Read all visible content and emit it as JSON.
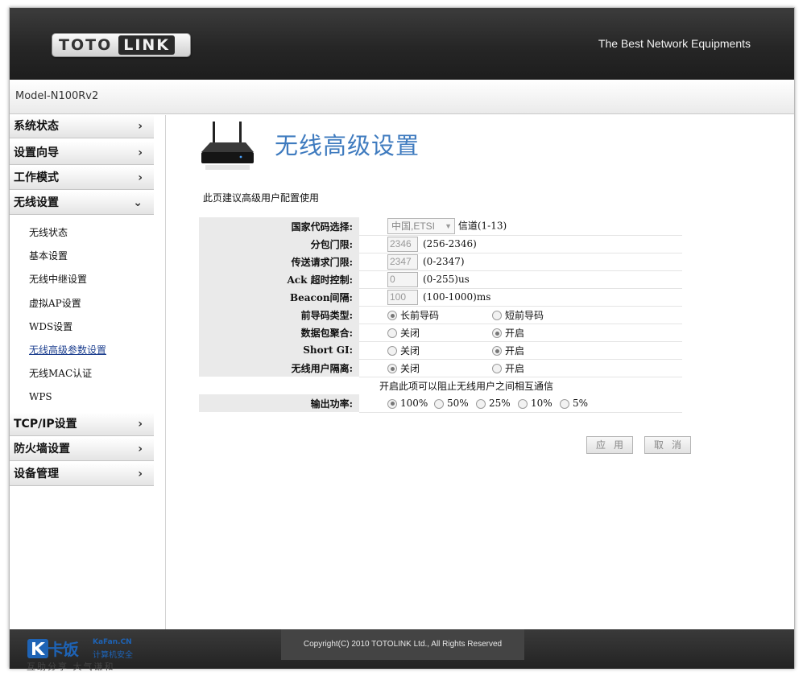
{
  "header": {
    "logo_left": "TOTO",
    "logo_right": "LINK",
    "slogan": "The Best Network Equipments"
  },
  "model": "Model-N100Rv2",
  "sidebar": {
    "groups": [
      {
        "label": "系统状态",
        "chevron": "›"
      },
      {
        "label": "设置向导",
        "chevron": "›"
      },
      {
        "label": "工作模式",
        "chevron": "›"
      },
      {
        "label": "无线设置",
        "chevron": "⌄"
      }
    ],
    "wireless_items": [
      "无线状态",
      "基本设置",
      "无线中继设置",
      "虚拟AP设置",
      "WDS设置",
      "无线高级参数设置",
      "无线MAC认证",
      "WPS"
    ],
    "groups_after": [
      {
        "label": "TCP/IP设置",
        "chevron": "›"
      },
      {
        "label": "防火墙设置",
        "chevron": "›"
      },
      {
        "label": "设备管理",
        "chevron": "›"
      }
    ]
  },
  "page": {
    "title": "无线高级设置",
    "intro": "此页建议高级用户配置使用",
    "country": {
      "label": "国家代码选择:",
      "value": "中国,ETSI",
      "suffix": "信道(1-13)"
    },
    "fragment": {
      "label": "分包门限:",
      "value": "2346",
      "range": "(256-2346)"
    },
    "rts": {
      "label": "传送请求门限:",
      "value": "2347",
      "range": "(0-2347)"
    },
    "ack": {
      "label": "Ack 超时控制:",
      "value": "0",
      "range": "(0-255)us"
    },
    "beacon": {
      "label": "Beacon间隔:",
      "value": "100",
      "range": "(100-1000)ms"
    },
    "preamble": {
      "label": "前导码类型:",
      "opt1": "长前导码",
      "opt2": "短前导码"
    },
    "aggregation": {
      "label": "数据包聚合:",
      "opt1": "关闭",
      "opt2": "开启"
    },
    "short_gi": {
      "label": "Short GI:",
      "opt1": "关闭",
      "opt2": "开启"
    },
    "isolation": {
      "label": "无线用户隔离:",
      "opt1": "关闭",
      "opt2": "开启",
      "note": "开启此项可以阻止无线用户之间相互通信"
    },
    "power": {
      "label": "输出功率:",
      "options": [
        "100%",
        "50%",
        "25%",
        "10%",
        "5%"
      ]
    },
    "apply": "应用",
    "cancel": "取消"
  },
  "footer": {
    "copyright": "Copyright(C) 2010 TOTOLINK Ltd.,   All Rights Reserved"
  },
  "watermark": {
    "name": "卡饭",
    "site": "KaFan.CN",
    "tag": "计算机安全",
    "motto": "互助分享 大气谦和"
  }
}
